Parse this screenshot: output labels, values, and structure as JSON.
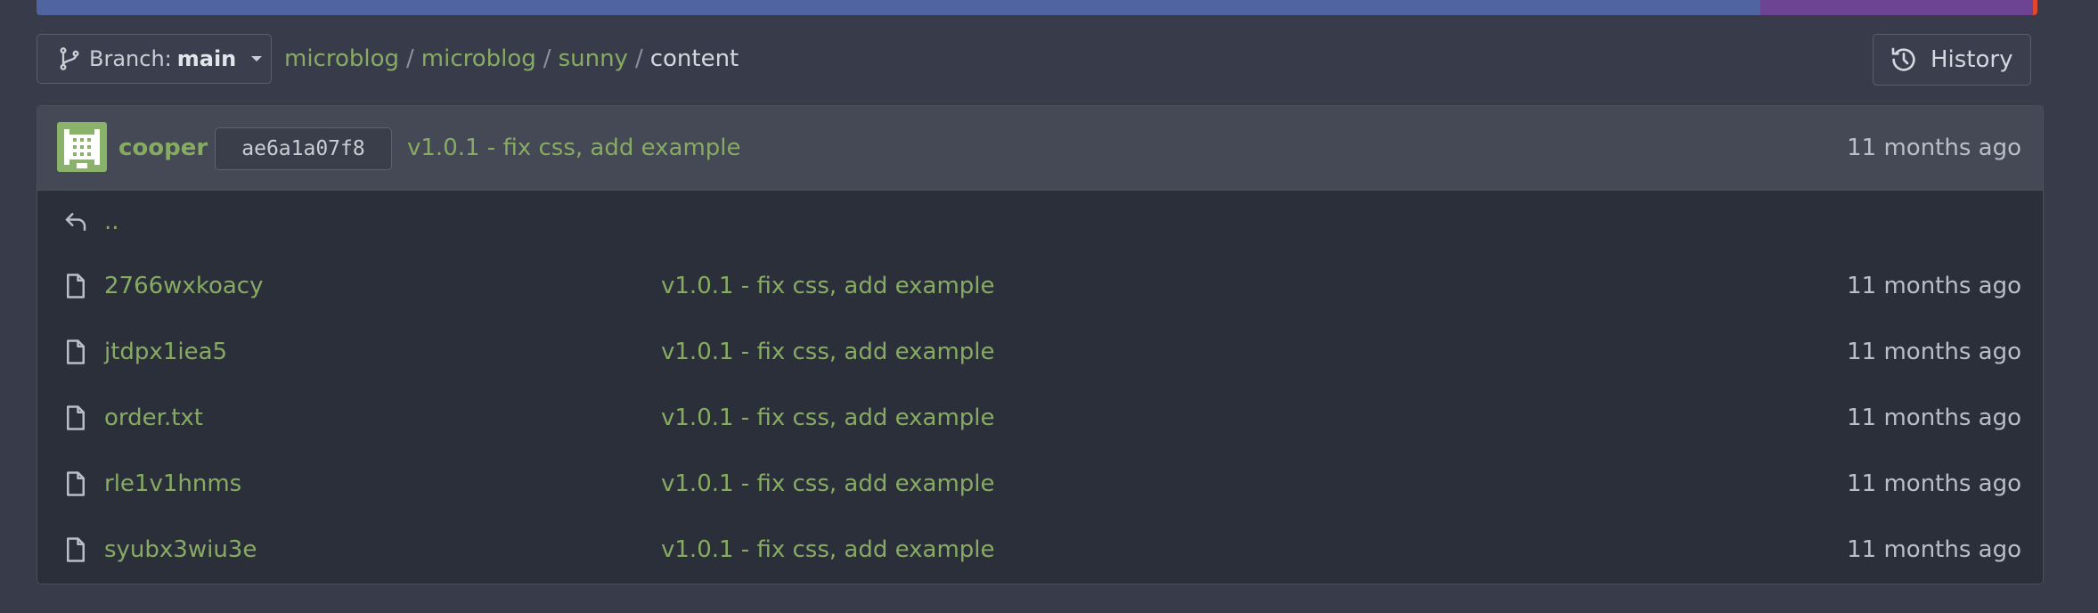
{
  "toolbar": {
    "branch_prefix": "Branch:",
    "branch_name": "main",
    "breadcrumb": [
      "microblog",
      "microblog",
      "sunny"
    ],
    "breadcrumb_current": "content",
    "separator": "/",
    "history_label": "History"
  },
  "commit": {
    "author": "cooper",
    "sha": "ae6a1a07f8",
    "message": "v1.0.1 - fix css, add example",
    "time": "11 months ago"
  },
  "files": {
    "parent_label": "..",
    "items": [
      {
        "name": "2766wxkoacy",
        "message": "v1.0.1 - fix css, add example",
        "time": "11 months ago"
      },
      {
        "name": "jtdpx1iea5",
        "message": "v1.0.1 - fix css, add example",
        "time": "11 months ago"
      },
      {
        "name": "order.txt",
        "message": "v1.0.1 - fix css, add example",
        "time": "11 months ago"
      },
      {
        "name": "rle1v1hnms",
        "message": "v1.0.1 - fix css, add example",
        "time": "11 months ago"
      },
      {
        "name": "syubx3wiu3e",
        "message": "v1.0.1 - fix css, add example",
        "time": "11 months ago"
      }
    ]
  },
  "colors": {
    "link_green": "#87ab63",
    "background": "#383c4a",
    "panel": "#2b2f3a",
    "header": "#444955"
  }
}
